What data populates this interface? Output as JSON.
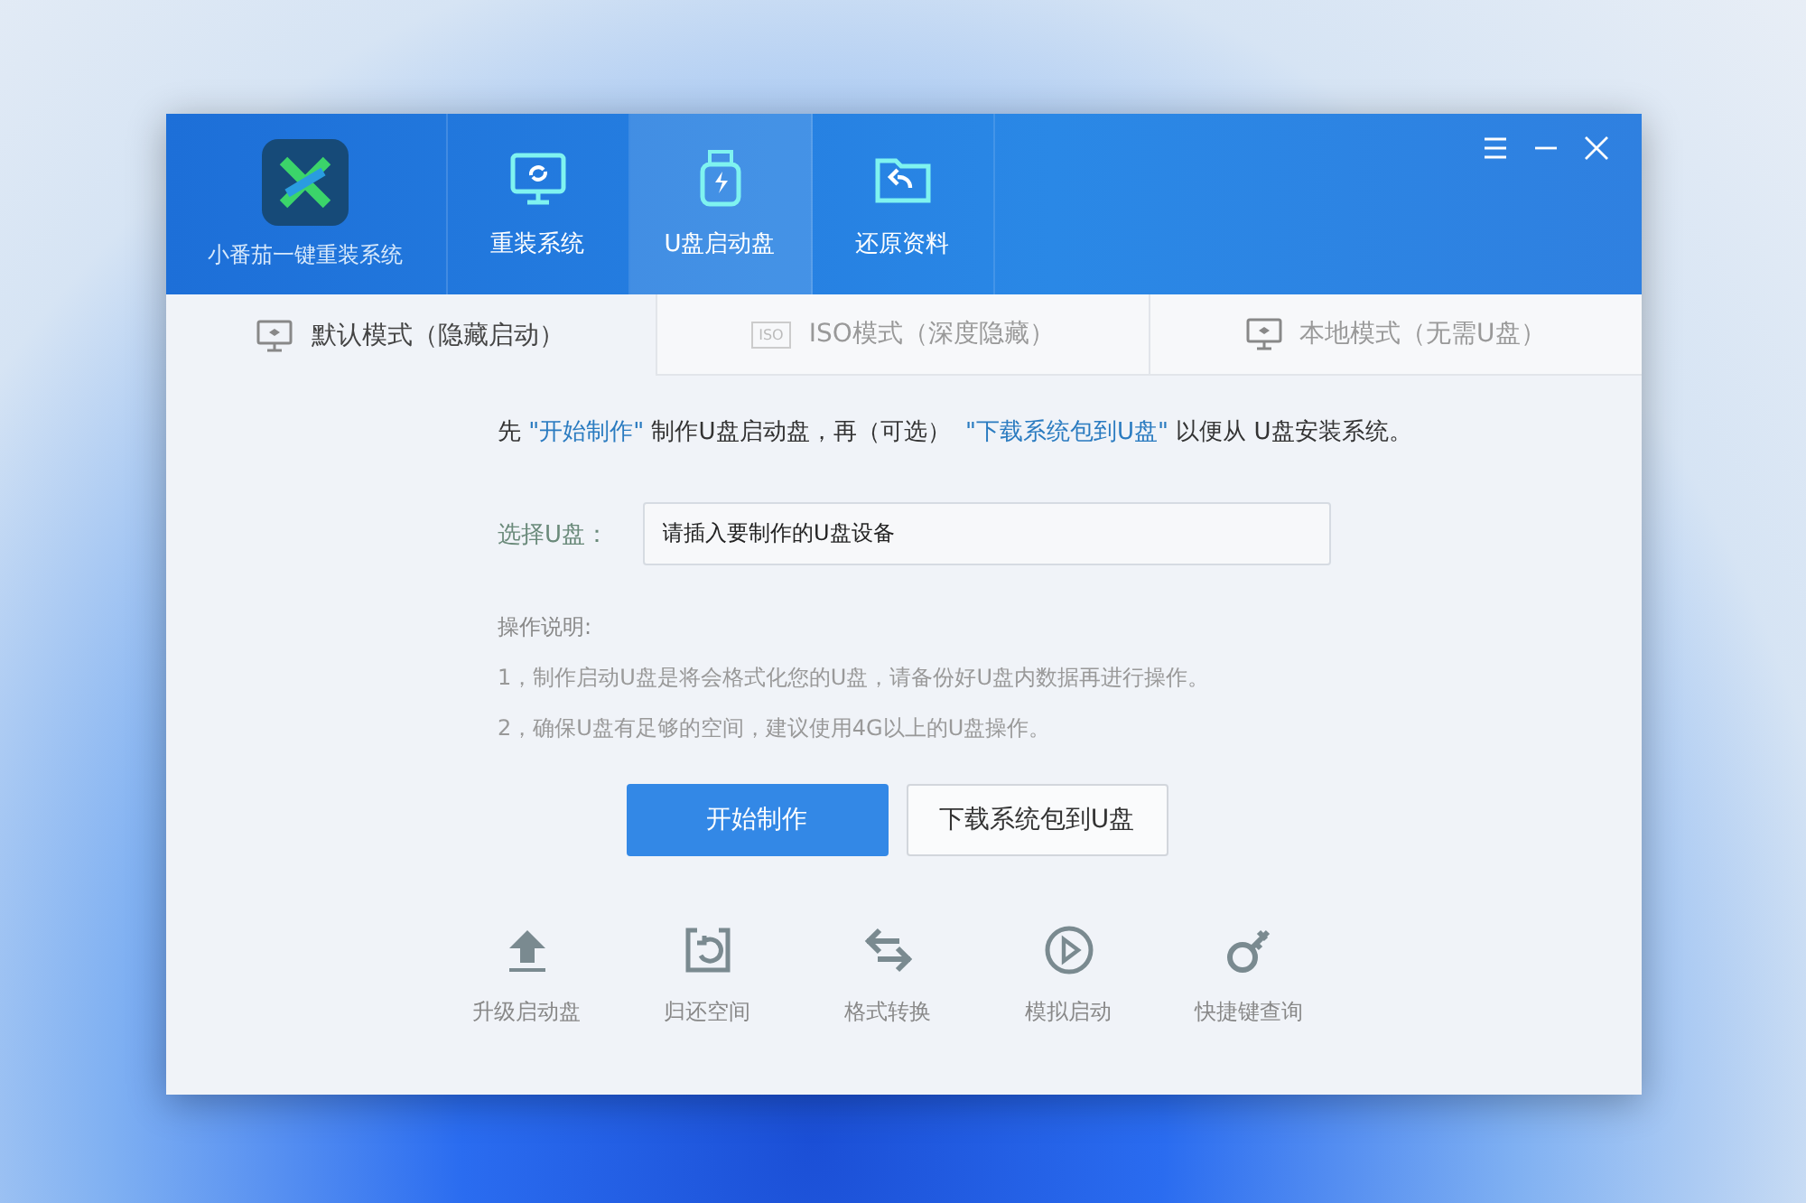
{
  "app": {
    "name": "小番茄一键重装系统"
  },
  "nav": [
    {
      "label": "重装系统",
      "selected": false
    },
    {
      "label": "U盘启动盘",
      "selected": true
    },
    {
      "label": "还原资料",
      "selected": false
    }
  ],
  "mode_tabs": [
    {
      "label": "默认模式（隐藏启动）",
      "selected": true
    },
    {
      "label": "ISO模式（深度隐藏）",
      "badge": "ISO",
      "selected": false
    },
    {
      "label": "本地模式（无需U盘）",
      "selected": false
    }
  ],
  "intro": [
    {
      "text": "先 ",
      "kind": "plain"
    },
    {
      "text": "\"开始制作\"",
      "kind": "link"
    },
    {
      "text": " 制作U盘启动盘，再（可选）  ",
      "kind": "plain"
    },
    {
      "text": "\"下载系统包到U盘\"",
      "kind": "link"
    },
    {
      "text": " 以便从 U盘安装系统。",
      "kind": "plain"
    }
  ],
  "device_field": {
    "label": "选择U盘：",
    "value": "请插入要制作的U盘设备"
  },
  "notes": {
    "title": "操作说明:",
    "items": [
      "1，制作启动U盘是将会格式化您的U盘，请备份好U盘内数据再进行操作。",
      "2，确保U盘有足够的空间，建议使用4G以上的U盘操作。"
    ]
  },
  "buttons": [
    {
      "label": "开始制作",
      "kind": "primary"
    },
    {
      "label": "下载系统包到U盘",
      "kind": "secondary"
    }
  ],
  "tools": [
    {
      "label": "升级启动盘"
    },
    {
      "label": "归还空间"
    },
    {
      "label": "格式转换"
    },
    {
      "label": "模拟启动"
    },
    {
      "label": "快捷键查询"
    }
  ]
}
